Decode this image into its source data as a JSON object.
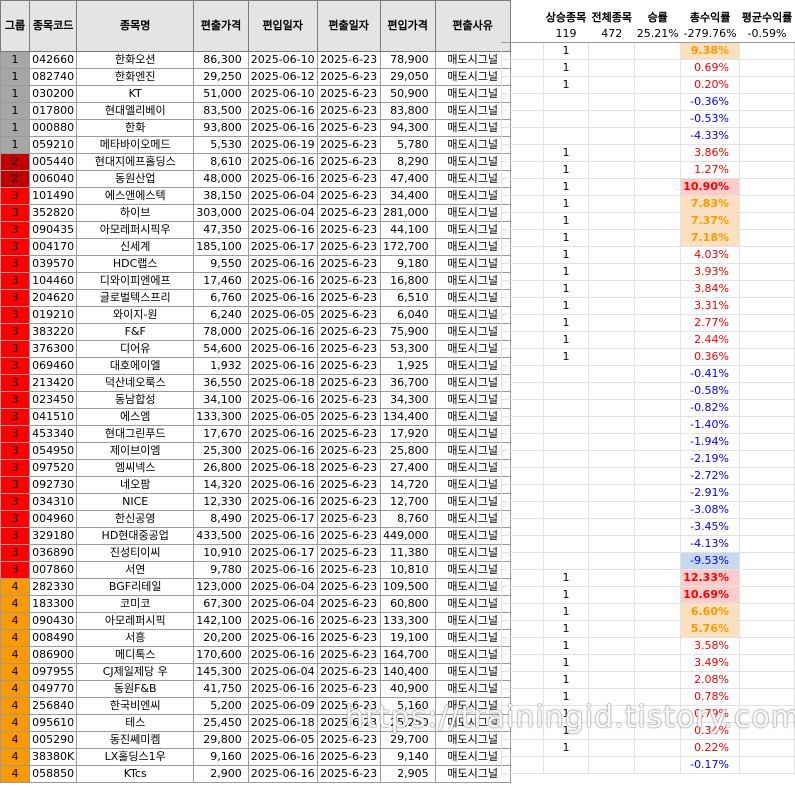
{
  "headers": {
    "group": "그룹",
    "code": "종목코드",
    "name": "종목명",
    "in_price": "편출가격",
    "in_date": "편입일자",
    "out_date": "편출일자",
    "entry_price": "편입가격",
    "reason": "편출사유"
  },
  "summary": {
    "labels": [
      "상승종목",
      "전체종목",
      "승률",
      "총수익률",
      "평균수익률"
    ],
    "values": [
      "119",
      "472",
      "25.21%",
      "-279.76%",
      "-0.59%"
    ]
  },
  "rows": [
    {
      "group": "1",
      "code": "042660",
      "name": "한화오션",
      "p1": "86,300",
      "d1": "2025-06-10",
      "d2": "2025-6-23",
      "p2": "78,900",
      "reason": "매도시그널",
      "up": "1",
      "ret": "9.38%"
    },
    {
      "group": "1",
      "code": "082740",
      "name": "한화엔진",
      "p1": "29,250",
      "d1": "2025-06-12",
      "d2": "2025-6-23",
      "p2": "29,050",
      "reason": "매도시그널",
      "up": "1",
      "ret": "0.69%"
    },
    {
      "group": "1",
      "code": "030200",
      "name": "KT",
      "p1": "51,000",
      "d1": "2025-06-10",
      "d2": "2025-6-23",
      "p2": "50,900",
      "reason": "매도시그널",
      "up": "1",
      "ret": "0.20%"
    },
    {
      "group": "1",
      "code": "017800",
      "name": "현대엘리베이",
      "p1": "83,500",
      "d1": "2025-06-16",
      "d2": "2025-6-23",
      "p2": "83,800",
      "reason": "매도시그널",
      "up": "",
      "ret": "-0.36%"
    },
    {
      "group": "1",
      "code": "000880",
      "name": "한화",
      "p1": "93,800",
      "d1": "2025-06-16",
      "d2": "2025-6-23",
      "p2": "94,300",
      "reason": "매도시그널",
      "up": "",
      "ret": "-0.53%"
    },
    {
      "group": "1",
      "code": "059210",
      "name": "메타바이오메드",
      "p1": "5,530",
      "d1": "2025-06-19",
      "d2": "2025-6-23",
      "p2": "5,780",
      "reason": "매도시그널",
      "up": "",
      "ret": "-4.33%"
    },
    {
      "group": "2",
      "code": "005440",
      "name": "현대지에프홀딩스",
      "p1": "8,610",
      "d1": "2025-06-16",
      "d2": "2025-6-23",
      "p2": "8,290",
      "reason": "매도시그널",
      "up": "1",
      "ret": "3.86%"
    },
    {
      "group": "2",
      "code": "006040",
      "name": "동원산업",
      "p1": "48,000",
      "d1": "2025-06-16",
      "d2": "2025-6-23",
      "p2": "47,400",
      "reason": "매도시그널",
      "up": "1",
      "ret": "1.27%"
    },
    {
      "group": "3",
      "code": "101490",
      "name": "에스앤에스텍",
      "p1": "38,150",
      "d1": "2025-06-04",
      "d2": "2025-6-23",
      "p2": "34,400",
      "reason": "매도시그널",
      "up": "1",
      "ret": "10.90%"
    },
    {
      "group": "3",
      "code": "352820",
      "name": "하이브",
      "p1": "303,000",
      "d1": "2025-06-04",
      "d2": "2025-6-23",
      "p2": "281,000",
      "reason": "매도시그널",
      "up": "1",
      "ret": "7.83%"
    },
    {
      "group": "3",
      "code": "090435",
      "name": "아모레퍼시픽우",
      "p1": "47,350",
      "d1": "2025-06-16",
      "d2": "2025-6-23",
      "p2": "44,100",
      "reason": "매도시그널",
      "up": "1",
      "ret": "7.37%"
    },
    {
      "group": "3",
      "code": "004170",
      "name": "신세계",
      "p1": "185,100",
      "d1": "2025-06-17",
      "d2": "2025-6-23",
      "p2": "172,700",
      "reason": "매도시그널",
      "up": "1",
      "ret": "7.18%"
    },
    {
      "group": "3",
      "code": "039570",
      "name": "HDC랩스",
      "p1": "9,550",
      "d1": "2025-06-16",
      "d2": "2025-6-23",
      "p2": "9,180",
      "reason": "매도시그널",
      "up": "1",
      "ret": "4.03%"
    },
    {
      "group": "3",
      "code": "104460",
      "name": "디와이피엔에프",
      "p1": "17,460",
      "d1": "2025-06-16",
      "d2": "2025-6-23",
      "p2": "16,800",
      "reason": "매도시그널",
      "up": "1",
      "ret": "3.93%"
    },
    {
      "group": "3",
      "code": "204620",
      "name": "글로벌텍스프리",
      "p1": "6,760",
      "d1": "2025-06-16",
      "d2": "2025-6-23",
      "p2": "6,510",
      "reason": "매도시그널",
      "up": "1",
      "ret": "3.84%"
    },
    {
      "group": "3",
      "code": "019210",
      "name": "와이지-원",
      "p1": "6,240",
      "d1": "2025-06-05",
      "d2": "2025-6-23",
      "p2": "6,040",
      "reason": "매도시그널",
      "up": "1",
      "ret": "3.31%"
    },
    {
      "group": "3",
      "code": "383220",
      "name": "F&F",
      "p1": "78,000",
      "d1": "2025-06-16",
      "d2": "2025-6-23",
      "p2": "75,900",
      "reason": "매도시그널",
      "up": "1",
      "ret": "2.77%"
    },
    {
      "group": "3",
      "code": "376300",
      "name": "디어유",
      "p1": "54,600",
      "d1": "2025-06-16",
      "d2": "2025-6-23",
      "p2": "53,300",
      "reason": "매도시그널",
      "up": "1",
      "ret": "2.44%"
    },
    {
      "group": "3",
      "code": "069460",
      "name": "대호에이엘",
      "p1": "1,932",
      "d1": "2025-06-16",
      "d2": "2025-6-23",
      "p2": "1,925",
      "reason": "매도시그널",
      "up": "1",
      "ret": "0.36%"
    },
    {
      "group": "3",
      "code": "213420",
      "name": "덕산네오룩스",
      "p1": "36,550",
      "d1": "2025-06-18",
      "d2": "2025-6-23",
      "p2": "36,700",
      "reason": "매도시그널",
      "up": "",
      "ret": "-0.41%"
    },
    {
      "group": "3",
      "code": "023450",
      "name": "동남합성",
      "p1": "34,100",
      "d1": "2025-06-16",
      "d2": "2025-6-23",
      "p2": "34,300",
      "reason": "매도시그널",
      "up": "",
      "ret": "-0.58%"
    },
    {
      "group": "3",
      "code": "041510",
      "name": "에스엠",
      "p1": "133,300",
      "d1": "2025-06-05",
      "d2": "2025-6-23",
      "p2": "134,400",
      "reason": "매도시그널",
      "up": "",
      "ret": "-0.82%"
    },
    {
      "group": "3",
      "code": "453340",
      "name": "현대그린푸드",
      "p1": "17,670",
      "d1": "2025-06-16",
      "d2": "2025-6-23",
      "p2": "17,920",
      "reason": "매도시그널",
      "up": "",
      "ret": "-1.40%"
    },
    {
      "group": "3",
      "code": "054950",
      "name": "제이브이엠",
      "p1": "25,300",
      "d1": "2025-06-16",
      "d2": "2025-6-23",
      "p2": "25,800",
      "reason": "매도시그널",
      "up": "",
      "ret": "-1.94%"
    },
    {
      "group": "3",
      "code": "097520",
      "name": "엠씨넥스",
      "p1": "26,800",
      "d1": "2025-06-18",
      "d2": "2025-6-23",
      "p2": "27,400",
      "reason": "매도시그널",
      "up": "",
      "ret": "-2.19%"
    },
    {
      "group": "3",
      "code": "092730",
      "name": "네오팜",
      "p1": "14,320",
      "d1": "2025-06-16",
      "d2": "2025-6-23",
      "p2": "14,720",
      "reason": "매도시그널",
      "up": "",
      "ret": "-2.72%"
    },
    {
      "group": "3",
      "code": "034310",
      "name": "NICE",
      "p1": "12,330",
      "d1": "2025-06-16",
      "d2": "2025-6-23",
      "p2": "12,700",
      "reason": "매도시그널",
      "up": "",
      "ret": "-2.91%"
    },
    {
      "group": "3",
      "code": "004960",
      "name": "한신공영",
      "p1": "8,490",
      "d1": "2025-06-17",
      "d2": "2025-6-23",
      "p2": "8,760",
      "reason": "매도시그널",
      "up": "",
      "ret": "-3.08%"
    },
    {
      "group": "3",
      "code": "329180",
      "name": "HD현대중공업",
      "p1": "433,500",
      "d1": "2025-06-16",
      "d2": "2025-6-23",
      "p2": "449,000",
      "reason": "매도시그널",
      "up": "",
      "ret": "-3.45%"
    },
    {
      "group": "3",
      "code": "036890",
      "name": "진성티이씨",
      "p1": "10,910",
      "d1": "2025-06-17",
      "d2": "2025-6-23",
      "p2": "11,380",
      "reason": "매도시그널",
      "up": "",
      "ret": "-4.13%"
    },
    {
      "group": "3",
      "code": "007860",
      "name": "서연",
      "p1": "9,780",
      "d1": "2025-06-16",
      "d2": "2025-6-23",
      "p2": "10,810",
      "reason": "매도시그널",
      "up": "",
      "ret": "-9.53%"
    },
    {
      "group": "4",
      "code": "282330",
      "name": "BGF리테일",
      "p1": "123,000",
      "d1": "2025-06-04",
      "d2": "2025-6-23",
      "p2": "109,500",
      "reason": "매도시그널",
      "up": "1",
      "ret": "12.33%"
    },
    {
      "group": "4",
      "code": "183300",
      "name": "코미코",
      "p1": "67,300",
      "d1": "2025-06-04",
      "d2": "2025-6-23",
      "p2": "60,800",
      "reason": "매도시그널",
      "up": "1",
      "ret": "10.69%"
    },
    {
      "group": "4",
      "code": "090430",
      "name": "아모레퍼시픽",
      "p1": "142,100",
      "d1": "2025-06-16",
      "d2": "2025-6-23",
      "p2": "133,300",
      "reason": "매도시그널",
      "up": "1",
      "ret": "6.60%"
    },
    {
      "group": "4",
      "code": "008490",
      "name": "서흥",
      "p1": "20,200",
      "d1": "2025-06-16",
      "d2": "2025-6-23",
      "p2": "19,100",
      "reason": "매도시그널",
      "up": "1",
      "ret": "5.76%"
    },
    {
      "group": "4",
      "code": "086900",
      "name": "메디톡스",
      "p1": "170,600",
      "d1": "2025-06-16",
      "d2": "2025-6-23",
      "p2": "164,700",
      "reason": "매도시그널",
      "up": "1",
      "ret": "3.58%"
    },
    {
      "group": "4",
      "code": "097955",
      "name": "CJ제일제당 우",
      "p1": "145,300",
      "d1": "2025-06-04",
      "d2": "2025-6-23",
      "p2": "140,400",
      "reason": "매도시그널",
      "up": "1",
      "ret": "3.49%"
    },
    {
      "group": "4",
      "code": "049770",
      "name": "동원F&B",
      "p1": "41,750",
      "d1": "2025-06-16",
      "d2": "2025-6-23",
      "p2": "40,900",
      "reason": "매도시그널",
      "up": "1",
      "ret": "2.08%"
    },
    {
      "group": "4",
      "code": "256840",
      "name": "한국비엔씨",
      "p1": "5,200",
      "d1": "2025-06-09",
      "d2": "2025-6-23",
      "p2": "5,160",
      "reason": "매도시그널",
      "up": "1",
      "ret": "0.78%"
    },
    {
      "group": "4",
      "code": "095610",
      "name": "테스",
      "p1": "25,450",
      "d1": "2025-06-18",
      "d2": "2025-6-23",
      "p2": "25,250",
      "reason": "매도시그널",
      "up": "1",
      "ret": "0.79%"
    },
    {
      "group": "4",
      "code": "005290",
      "name": "동진쎄미켐",
      "p1": "29,800",
      "d1": "2025-06-05",
      "d2": "2025-6-23",
      "p2": "29,700",
      "reason": "매도시그널",
      "up": "1",
      "ret": "0.34%"
    },
    {
      "group": "4",
      "code": "38380K",
      "name": "LX홀딩스1우",
      "p1": "9,160",
      "d1": "2025-06-16",
      "d2": "2025-6-23",
      "p2": "9,140",
      "reason": "매도시그널",
      "up": "1",
      "ret": "0.22%"
    },
    {
      "group": "4",
      "code": "058850",
      "name": "KTcs",
      "p1": "2,900",
      "d1": "2025-06-16",
      "d2": "2025-6-23",
      "p2": "2,905",
      "reason": "매도시그널",
      "up": "",
      "ret": "-0.17%"
    }
  ],
  "highlights": {
    "strong_red": [
      "10.90%",
      "12.33%",
      "10.69%"
    ],
    "orange": [
      "9.38%",
      "7.83%",
      "7.37%",
      "7.18%",
      "6.60%",
      "5.76%"
    ],
    "blue": [
      "-9.53%"
    ]
  },
  "watermark": "https://trainingid.tistory.com"
}
